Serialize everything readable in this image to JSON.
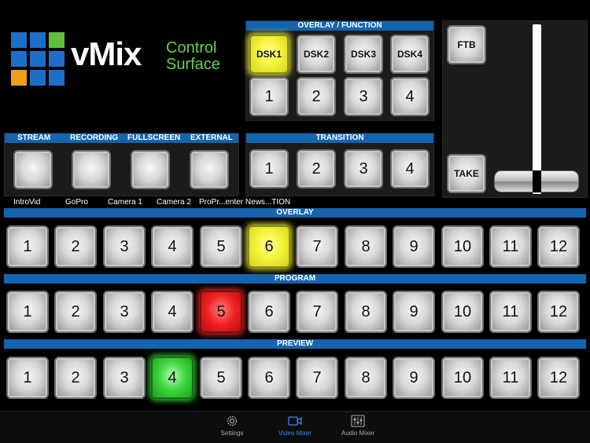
{
  "logo": {
    "title": "vMix",
    "subtitle_line1": "Control",
    "subtitle_line2": "Surface",
    "grid_colors": [
      "#1d6fc9",
      "#1d6fc9",
      "#5fbf3b",
      "#1d6fc9",
      "#1d6fc9",
      "#1d6fc9",
      "#f29b1d",
      "#1d6fc9",
      "#1d6fc9"
    ]
  },
  "overlay_function": {
    "header": "OVERLAY / FUNCTION",
    "dsk": [
      "DSK1",
      "DSK2",
      "DSK3",
      "DSK4"
    ],
    "numbers": [
      "1",
      "2",
      "3",
      "4"
    ],
    "active_dsk": "DSK1"
  },
  "ftb": {
    "label": "FTB"
  },
  "take": {
    "label": "TAKE"
  },
  "outputs": {
    "headers": [
      "STREAM",
      "RECORDING",
      "FULLSCREEN",
      "EXTERNAL"
    ]
  },
  "transition": {
    "header": "TRANSITION",
    "buttons": [
      "1",
      "2",
      "3",
      "4"
    ]
  },
  "input_names": [
    "IntroVid",
    "GoPro",
    "Camera 1",
    "Camera 2",
    "ProPr...enter News...TION"
  ],
  "overlay_row": {
    "header": "OVERLAY",
    "buttons": [
      "1",
      "2",
      "3",
      "4",
      "5",
      "6",
      "7",
      "8",
      "9",
      "10",
      "11",
      "12"
    ],
    "active": "6",
    "active_color": "#f4f43b"
  },
  "program_row": {
    "header": "PROGRAM",
    "buttons": [
      "1",
      "2",
      "3",
      "4",
      "5",
      "6",
      "7",
      "8",
      "9",
      "10",
      "11",
      "12"
    ],
    "active": "5",
    "active_color": "#f02020"
  },
  "preview_row": {
    "header": "PREVIEW",
    "buttons": [
      "1",
      "2",
      "3",
      "4",
      "5",
      "6",
      "7",
      "8",
      "9",
      "10",
      "11",
      "12"
    ],
    "active": "4",
    "active_color": "#3ad53a"
  },
  "tabs": [
    {
      "label": "Settings",
      "icon": "gear-icon",
      "active": false
    },
    {
      "label": "Video Mixer",
      "icon": "video-camera-icon",
      "active": true
    },
    {
      "label": "Audio Mixer",
      "icon": "sliders-icon",
      "active": false
    }
  ],
  "colors": {
    "header_blue": "#1464b0",
    "tab_active": "#2e8cf0",
    "logo_green": "#5fd34a"
  }
}
